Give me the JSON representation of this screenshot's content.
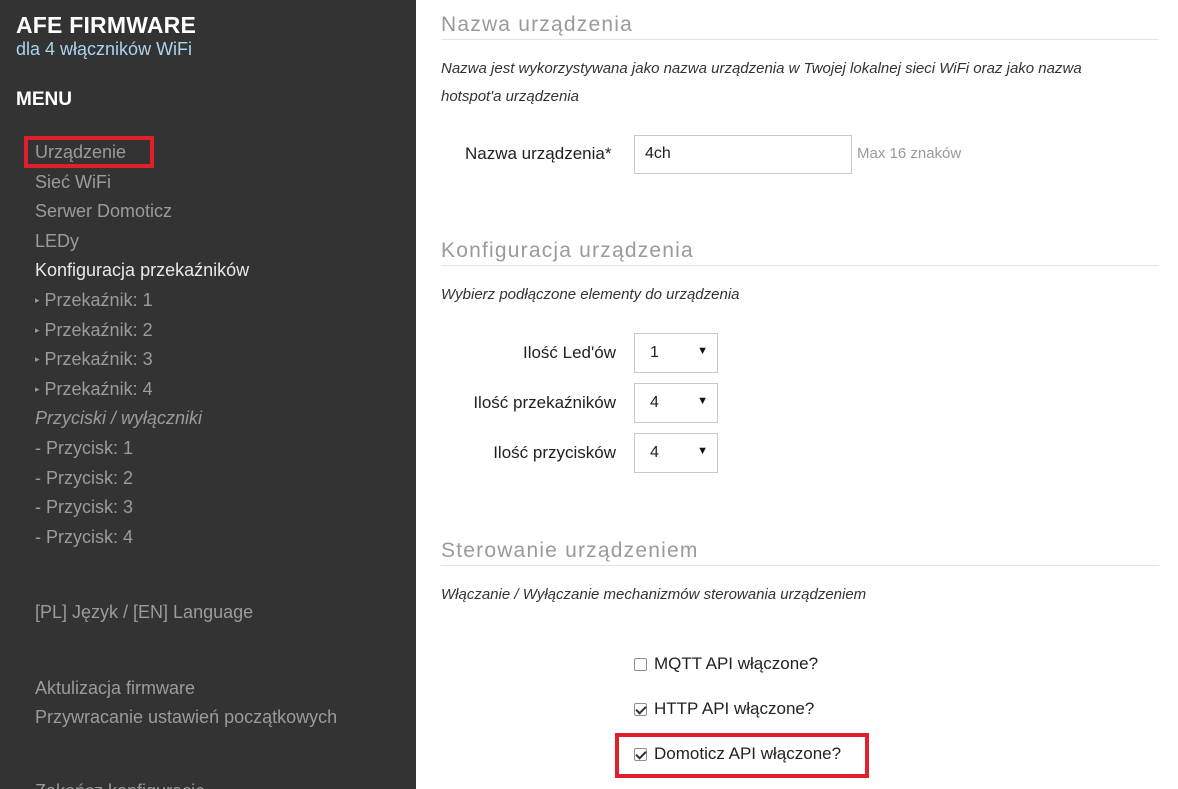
{
  "sidebar": {
    "brand_title": "AFE FIRMWARE",
    "brand_subtitle": "dla 4 włączników WiFi",
    "menu_heading": "MENU",
    "items": {
      "device": "Urządzenie",
      "wifi": "Sieć WiFi",
      "domoticz": "Serwer Domoticz",
      "leds": "LEDy",
      "relays_header": "Konfiguracja przekaźników",
      "relay1": "Przekaźnik: 1",
      "relay2": "Przekaźnik: 2",
      "relay3": "Przekaźnik: 3",
      "relay4": "Przekaźnik: 4",
      "buttons_header": "Przyciski / wyłączniki",
      "button1": "- Przycisk: 1",
      "button2": "- Przycisk: 2",
      "button3": "- Przycisk: 3",
      "button4": "- Przycisk: 4",
      "language": "[PL] Język / [EN] Language",
      "firmware_update": "Aktulizacja firmware",
      "reset": "Przywracanie ustawień początkowych",
      "finish_config": "Zakończ konfigurację"
    },
    "highlight_color": "#e0202b"
  },
  "device_name": {
    "title": "Nazwa urządzenia",
    "description": "Nazwa jest wykorzystywana jako nazwa urządzenia w Twojej lokalnej sieci WiFi oraz jako nazwa hotspot'a urządzenia",
    "field_label": "Nazwa urządzenia*",
    "field_value": "4ch",
    "hint": "Max 16 znaków"
  },
  "device_config": {
    "title": "Konfiguracja urządzenia",
    "description": "Wybierz podłączone elementy do urządzenia",
    "led_label": "Ilość Led'ów",
    "led_value": "1",
    "relay_label": "Ilość przekaźników",
    "relay_value": "4",
    "button_label": "Ilość przycisków",
    "button_value": "4"
  },
  "device_control": {
    "title": "Sterowanie urządzeniem",
    "description": "Włączanie / Wyłączanie mechanizmów sterowania urządzeniem",
    "mqtt_label": "MQTT API włączone?",
    "mqtt_checked": false,
    "http_label": "HTTP API włączone?",
    "http_checked": true,
    "domoticz_label": "Domoticz API włączone?",
    "domoticz_checked": true
  }
}
